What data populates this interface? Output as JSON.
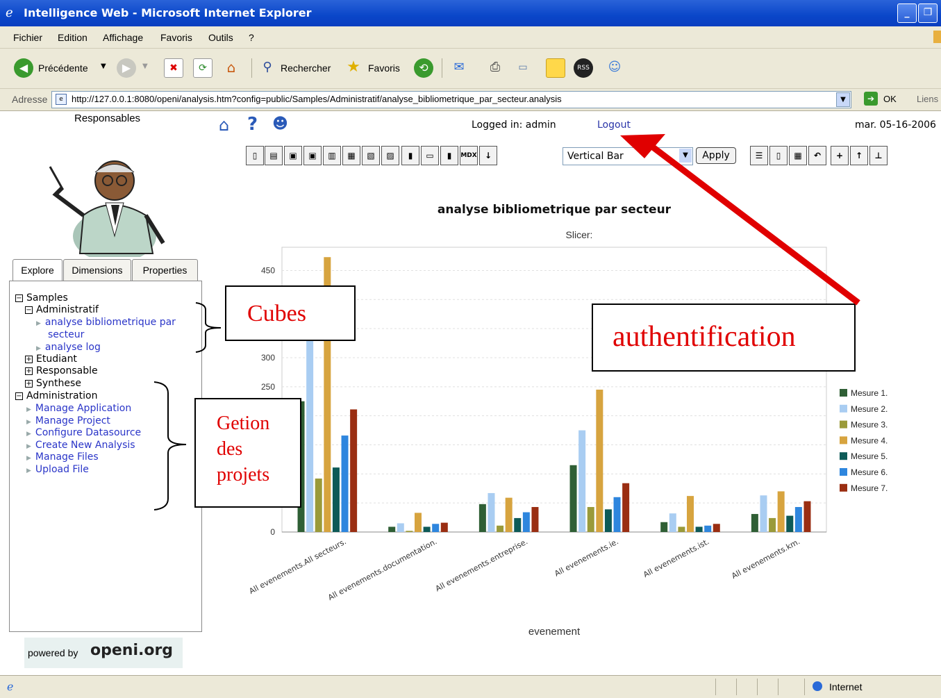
{
  "window": {
    "title": "Intelligence Web - Microsoft Internet Explorer"
  },
  "menu": [
    "Fichier",
    "Edition",
    "Affichage",
    "Favoris",
    "Outils",
    "?"
  ],
  "toolbar": {
    "back_label": "Précédente",
    "search_label": "Rechercher",
    "favorites_label": "Favoris",
    "rss_label": "RSS"
  },
  "address": {
    "label": "Adresse",
    "url": "http://127.0.0.1:8080/openi/analysis.htm?config=public/Samples/Administratif/analyse_bibliometrique_par_secteur.analysis",
    "go_label": "OK",
    "links_label": "Liens"
  },
  "header": {
    "responsables": "Responsables",
    "logged_in": "Logged in:  admin",
    "logout": "Logout",
    "date": "mar. 05-16-2006"
  },
  "chart_toolbar": {
    "chart_type": "Vertical Bar",
    "apply": "Apply",
    "mdx": "MDX"
  },
  "tabs": [
    "Explore",
    "Dimensions",
    "Properties"
  ],
  "tree": {
    "samples": "Samples",
    "administratif": "Administratif",
    "cube1": "analyse bibliometrique par",
    "cube1b": "secteur",
    "cube2": "analyse log",
    "etudiant": "Etudiant",
    "responsable": "Responsable",
    "synthese": "Synthese",
    "administration": "Administration",
    "admin_items": [
      "Manage Application",
      "Manage Project",
      "Configure Datasource",
      "Create New Analysis",
      "Manage Files",
      "Upload File"
    ]
  },
  "powered": {
    "text": "powered by",
    "brand": "openi.org"
  },
  "annotations": {
    "cubes": "Cubes",
    "auth": "authentification",
    "projects": [
      "Getion",
      "des",
      "projets"
    ]
  },
  "status": {
    "zone": "Internet"
  },
  "colors": {
    "accent": "#0a46c9",
    "annotation": "#e00000"
  },
  "chart_data": {
    "type": "bar",
    "title": "analyse bibliometrique par secteur",
    "subtitle": "Slicer:",
    "xlabel": "evenement",
    "ylabel": "",
    "ylim": [
      0,
      490
    ],
    "yticks": [
      0,
      250,
      300,
      450
    ],
    "categories": [
      "All evenements.All secteurs.",
      "All evenements.documentation.",
      "All evenements.entreprise.",
      "All evenements.ie.",
      "All evenements.ist.",
      "All evenements.km."
    ],
    "series": [
      {
        "name": "Mesure 1.",
        "color": "#2f5f35",
        "values": [
          225,
          9,
          48,
          115,
          17,
          31
        ]
      },
      {
        "name": "Mesure 2.",
        "color": "#a9cdf2",
        "values": [
          410,
          15,
          67,
          175,
          32,
          63
        ]
      },
      {
        "name": "Mesure 3.",
        "color": "#9a9a3a",
        "values": [
          92,
          2,
          11,
          43,
          9,
          24
        ]
      },
      {
        "name": "Mesure 4.",
        "color": "#d7a43f",
        "values": [
          473,
          33,
          59,
          245,
          62,
          70
        ]
      },
      {
        "name": "Mesure 5.",
        "color": "#0d5a57",
        "values": [
          111,
          9,
          24,
          39,
          9,
          28
        ]
      },
      {
        "name": "Mesure 6.",
        "color": "#2e86de",
        "values": [
          166,
          14,
          34,
          60,
          11,
          43
        ]
      },
      {
        "name": "Mesure 7.",
        "color": "#9a2e12",
        "values": [
          211,
          16,
          43,
          84,
          14,
          53
        ]
      }
    ],
    "legend": "right"
  }
}
